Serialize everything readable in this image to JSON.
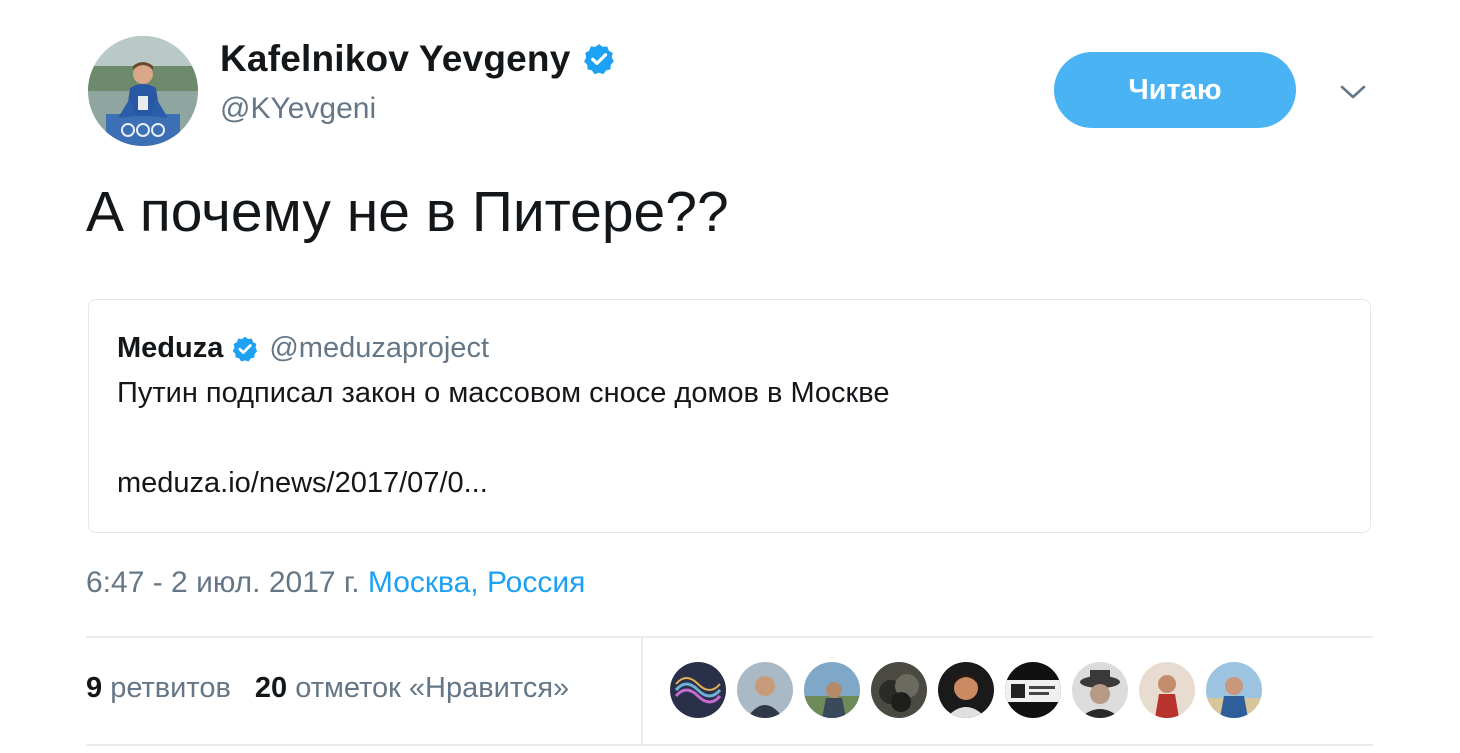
{
  "author": {
    "display_name": "Kafelnikov Yevgeny",
    "handle": "@KYevgeni",
    "verified_icon": "verified-badge-icon"
  },
  "follow_button": {
    "label": "Читаю"
  },
  "menu_caret": {
    "icon": "chevron-down-icon"
  },
  "tweet": {
    "text": "А почему не в Питере??"
  },
  "quoted_tweet": {
    "name": "Meduza",
    "handle": "@meduzaproject",
    "text": "Путин подписал закон о массовом сносе домов в Москве",
    "link": "meduza.io/news/2017/07/0..."
  },
  "meta": {
    "time": "6:47 - 2 июл. 2017 г.",
    "location": "Москва, Россия"
  },
  "stats": {
    "retweets_count": "9",
    "retweets_label": "ретвитов",
    "likes_count": "20",
    "likes_label": "отметок «Нравится»"
  },
  "colors": {
    "accent": "#1da1f2",
    "button": "#4ab3f4",
    "muted": "#657786",
    "border": "#e1e8ed"
  }
}
